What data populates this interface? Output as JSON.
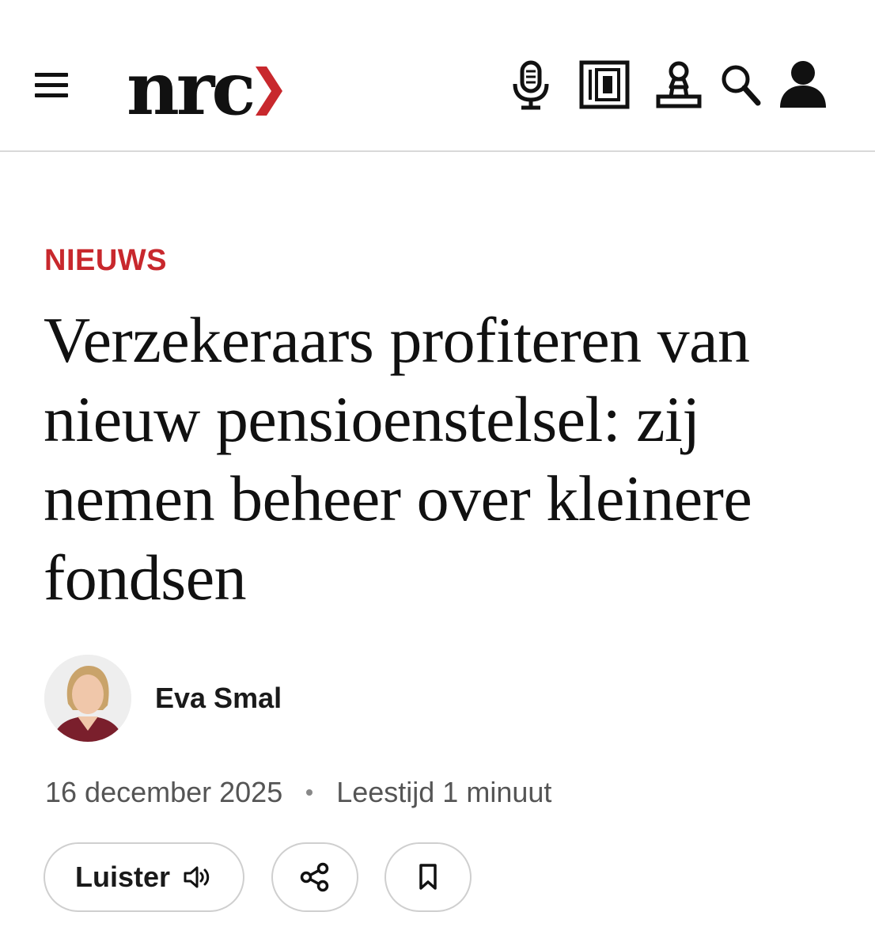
{
  "header": {
    "logo_text": "nrc",
    "brand_color": "#c8282d",
    "icons": [
      "menu-icon",
      "microphone-icon",
      "newspaper-icon",
      "puzzle-piece-icon",
      "search-icon",
      "account-icon"
    ]
  },
  "article": {
    "section": "NIEUWS",
    "headline": "Verzekeraars profiteren van nieuw pensioenstelsel: zij nemen beheer over kleinere fondsen",
    "author": {
      "name": "Eva Smal"
    },
    "date": "16 december 2025",
    "reading_time": "Leestijd 1 minuut"
  },
  "actions": {
    "listen_label": "Luister"
  }
}
